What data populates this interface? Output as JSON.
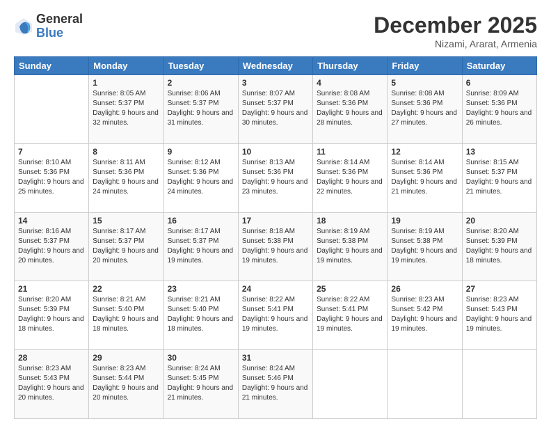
{
  "header": {
    "logo_general": "General",
    "logo_blue": "Blue",
    "month_year": "December 2025",
    "location": "Nizami, Ararat, Armenia"
  },
  "calendar": {
    "days_of_week": [
      "Sunday",
      "Monday",
      "Tuesday",
      "Wednesday",
      "Thursday",
      "Friday",
      "Saturday"
    ],
    "weeks": [
      [
        {
          "day": "",
          "info": ""
        },
        {
          "day": "1",
          "info": "Sunrise: 8:05 AM\nSunset: 5:37 PM\nDaylight: 9 hours\nand 32 minutes."
        },
        {
          "day": "2",
          "info": "Sunrise: 8:06 AM\nSunset: 5:37 PM\nDaylight: 9 hours\nand 31 minutes."
        },
        {
          "day": "3",
          "info": "Sunrise: 8:07 AM\nSunset: 5:37 PM\nDaylight: 9 hours\nand 30 minutes."
        },
        {
          "day": "4",
          "info": "Sunrise: 8:08 AM\nSunset: 5:36 PM\nDaylight: 9 hours\nand 28 minutes."
        },
        {
          "day": "5",
          "info": "Sunrise: 8:08 AM\nSunset: 5:36 PM\nDaylight: 9 hours\nand 27 minutes."
        },
        {
          "day": "6",
          "info": "Sunrise: 8:09 AM\nSunset: 5:36 PM\nDaylight: 9 hours\nand 26 minutes."
        }
      ],
      [
        {
          "day": "7",
          "info": "Sunrise: 8:10 AM\nSunset: 5:36 PM\nDaylight: 9 hours\nand 25 minutes."
        },
        {
          "day": "8",
          "info": "Sunrise: 8:11 AM\nSunset: 5:36 PM\nDaylight: 9 hours\nand 24 minutes."
        },
        {
          "day": "9",
          "info": "Sunrise: 8:12 AM\nSunset: 5:36 PM\nDaylight: 9 hours\nand 24 minutes."
        },
        {
          "day": "10",
          "info": "Sunrise: 8:13 AM\nSunset: 5:36 PM\nDaylight: 9 hours\nand 23 minutes."
        },
        {
          "day": "11",
          "info": "Sunrise: 8:14 AM\nSunset: 5:36 PM\nDaylight: 9 hours\nand 22 minutes."
        },
        {
          "day": "12",
          "info": "Sunrise: 8:14 AM\nSunset: 5:36 PM\nDaylight: 9 hours\nand 21 minutes."
        },
        {
          "day": "13",
          "info": "Sunrise: 8:15 AM\nSunset: 5:37 PM\nDaylight: 9 hours\nand 21 minutes."
        }
      ],
      [
        {
          "day": "14",
          "info": "Sunrise: 8:16 AM\nSunset: 5:37 PM\nDaylight: 9 hours\nand 20 minutes."
        },
        {
          "day": "15",
          "info": "Sunrise: 8:17 AM\nSunset: 5:37 PM\nDaylight: 9 hours\nand 20 minutes."
        },
        {
          "day": "16",
          "info": "Sunrise: 8:17 AM\nSunset: 5:37 PM\nDaylight: 9 hours\nand 19 minutes."
        },
        {
          "day": "17",
          "info": "Sunrise: 8:18 AM\nSunset: 5:38 PM\nDaylight: 9 hours\nand 19 minutes."
        },
        {
          "day": "18",
          "info": "Sunrise: 8:19 AM\nSunset: 5:38 PM\nDaylight: 9 hours\nand 19 minutes."
        },
        {
          "day": "19",
          "info": "Sunrise: 8:19 AM\nSunset: 5:38 PM\nDaylight: 9 hours\nand 19 minutes."
        },
        {
          "day": "20",
          "info": "Sunrise: 8:20 AM\nSunset: 5:39 PM\nDaylight: 9 hours\nand 18 minutes."
        }
      ],
      [
        {
          "day": "21",
          "info": "Sunrise: 8:20 AM\nSunset: 5:39 PM\nDaylight: 9 hours\nand 18 minutes."
        },
        {
          "day": "22",
          "info": "Sunrise: 8:21 AM\nSunset: 5:40 PM\nDaylight: 9 hours\nand 18 minutes."
        },
        {
          "day": "23",
          "info": "Sunrise: 8:21 AM\nSunset: 5:40 PM\nDaylight: 9 hours\nand 18 minutes."
        },
        {
          "day": "24",
          "info": "Sunrise: 8:22 AM\nSunset: 5:41 PM\nDaylight: 9 hours\nand 19 minutes."
        },
        {
          "day": "25",
          "info": "Sunrise: 8:22 AM\nSunset: 5:41 PM\nDaylight: 9 hours\nand 19 minutes."
        },
        {
          "day": "26",
          "info": "Sunrise: 8:23 AM\nSunset: 5:42 PM\nDaylight: 9 hours\nand 19 minutes."
        },
        {
          "day": "27",
          "info": "Sunrise: 8:23 AM\nSunset: 5:43 PM\nDaylight: 9 hours\nand 19 minutes."
        }
      ],
      [
        {
          "day": "28",
          "info": "Sunrise: 8:23 AM\nSunset: 5:43 PM\nDaylight: 9 hours\nand 20 minutes."
        },
        {
          "day": "29",
          "info": "Sunrise: 8:23 AM\nSunset: 5:44 PM\nDaylight: 9 hours\nand 20 minutes."
        },
        {
          "day": "30",
          "info": "Sunrise: 8:24 AM\nSunset: 5:45 PM\nDaylight: 9 hours\nand 21 minutes."
        },
        {
          "day": "31",
          "info": "Sunrise: 8:24 AM\nSunset: 5:46 PM\nDaylight: 9 hours\nand 21 minutes."
        },
        {
          "day": "",
          "info": ""
        },
        {
          "day": "",
          "info": ""
        },
        {
          "day": "",
          "info": ""
        }
      ]
    ]
  }
}
